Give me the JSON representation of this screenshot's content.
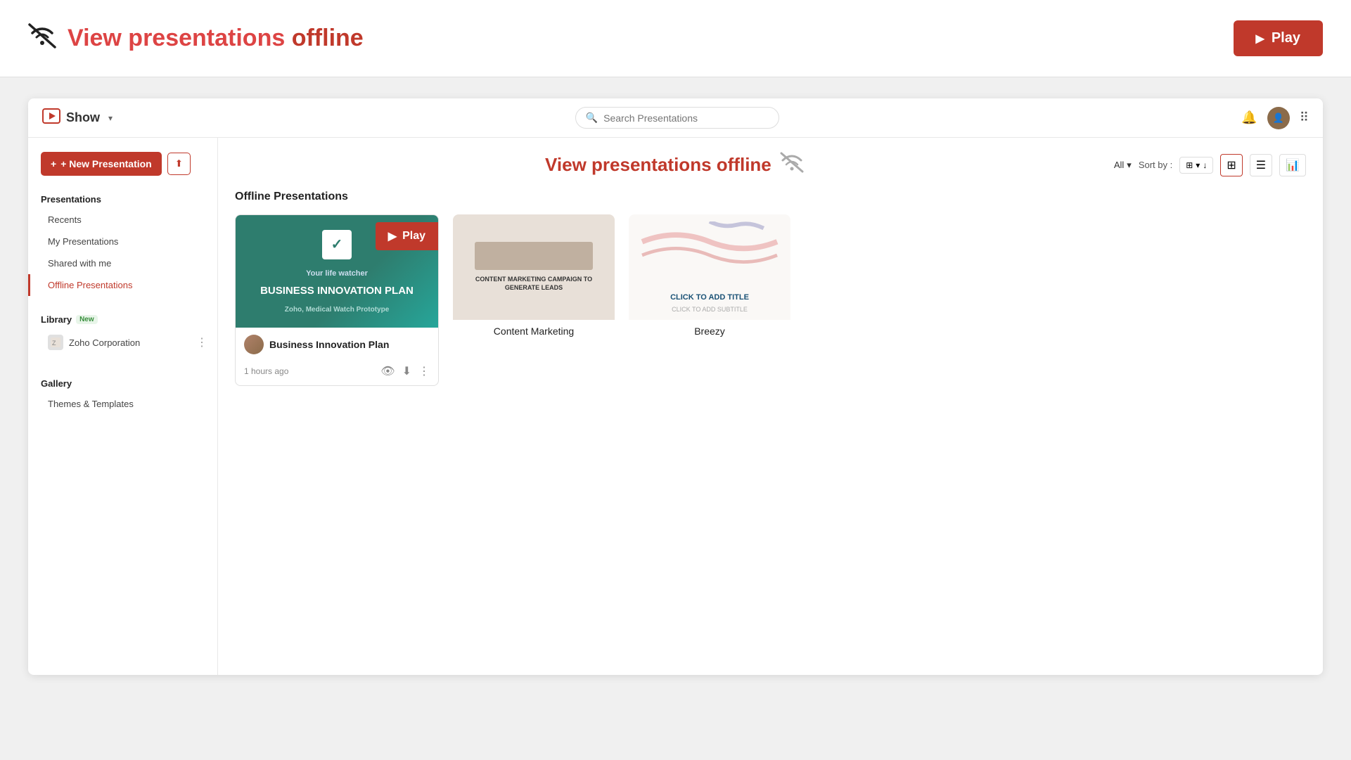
{
  "topBar": {
    "title": "View presentations",
    "titleHighlight": "offline",
    "playLabel": "Play",
    "wifiSlashIcon": "wifi-slash-icon"
  },
  "appHeader": {
    "appName": "Show",
    "searchPlaceholder": "Search Presentations",
    "bellIcon": "bell-icon",
    "gridIcon": "grid-icon"
  },
  "sidebar": {
    "newPresentationLabel": "+ New Presentation",
    "uploadLabel": "↑",
    "sections": [
      {
        "title": "Presentations",
        "items": [
          {
            "label": "Recents",
            "active": false
          },
          {
            "label": "My Presentations",
            "active": false
          },
          {
            "label": "Shared with me",
            "active": false
          },
          {
            "label": "Offline Presentations",
            "active": true
          }
        ]
      }
    ],
    "libraryTitle": "Library",
    "libraryBadge": "New",
    "libraryItems": [
      {
        "label": "Zoho Corporation"
      }
    ],
    "galleryTitle": "Gallery",
    "galleryItems": [
      {
        "label": "Themes & Templates"
      }
    ]
  },
  "mainContent": {
    "offlineBannerText": "View presentations",
    "offlineBannerHighlight": "offline",
    "filterLabel": "All",
    "sortLabel": "Sort by :",
    "sortByLabel": "Sort by",
    "sectionTitle": "Offline Presentations",
    "presentations": [
      {
        "id": 1,
        "title": "Business Innovation Plan",
        "time": "1 hours ago",
        "bgColor": "#2e7d6e",
        "subText": "BUSINESS INNOVATION PLAN",
        "subSub": "Zoho, Medical Watch Prototype",
        "hasPlayOverlay": true,
        "playLabel": "Play"
      },
      {
        "id": 2,
        "title": "Content Marketing",
        "time": "",
        "bgColor": "#f0ece8",
        "subText": "CONTENT MARKETING CAMPAIGN TO GENERATE LEADS",
        "hasPlayOverlay": false
      },
      {
        "id": 3,
        "title": "Breezy",
        "time": "",
        "bgColor": "#f8f4f0",
        "subText": "CLICK TO ADD TITLE",
        "hasPlayOverlay": false
      }
    ]
  }
}
